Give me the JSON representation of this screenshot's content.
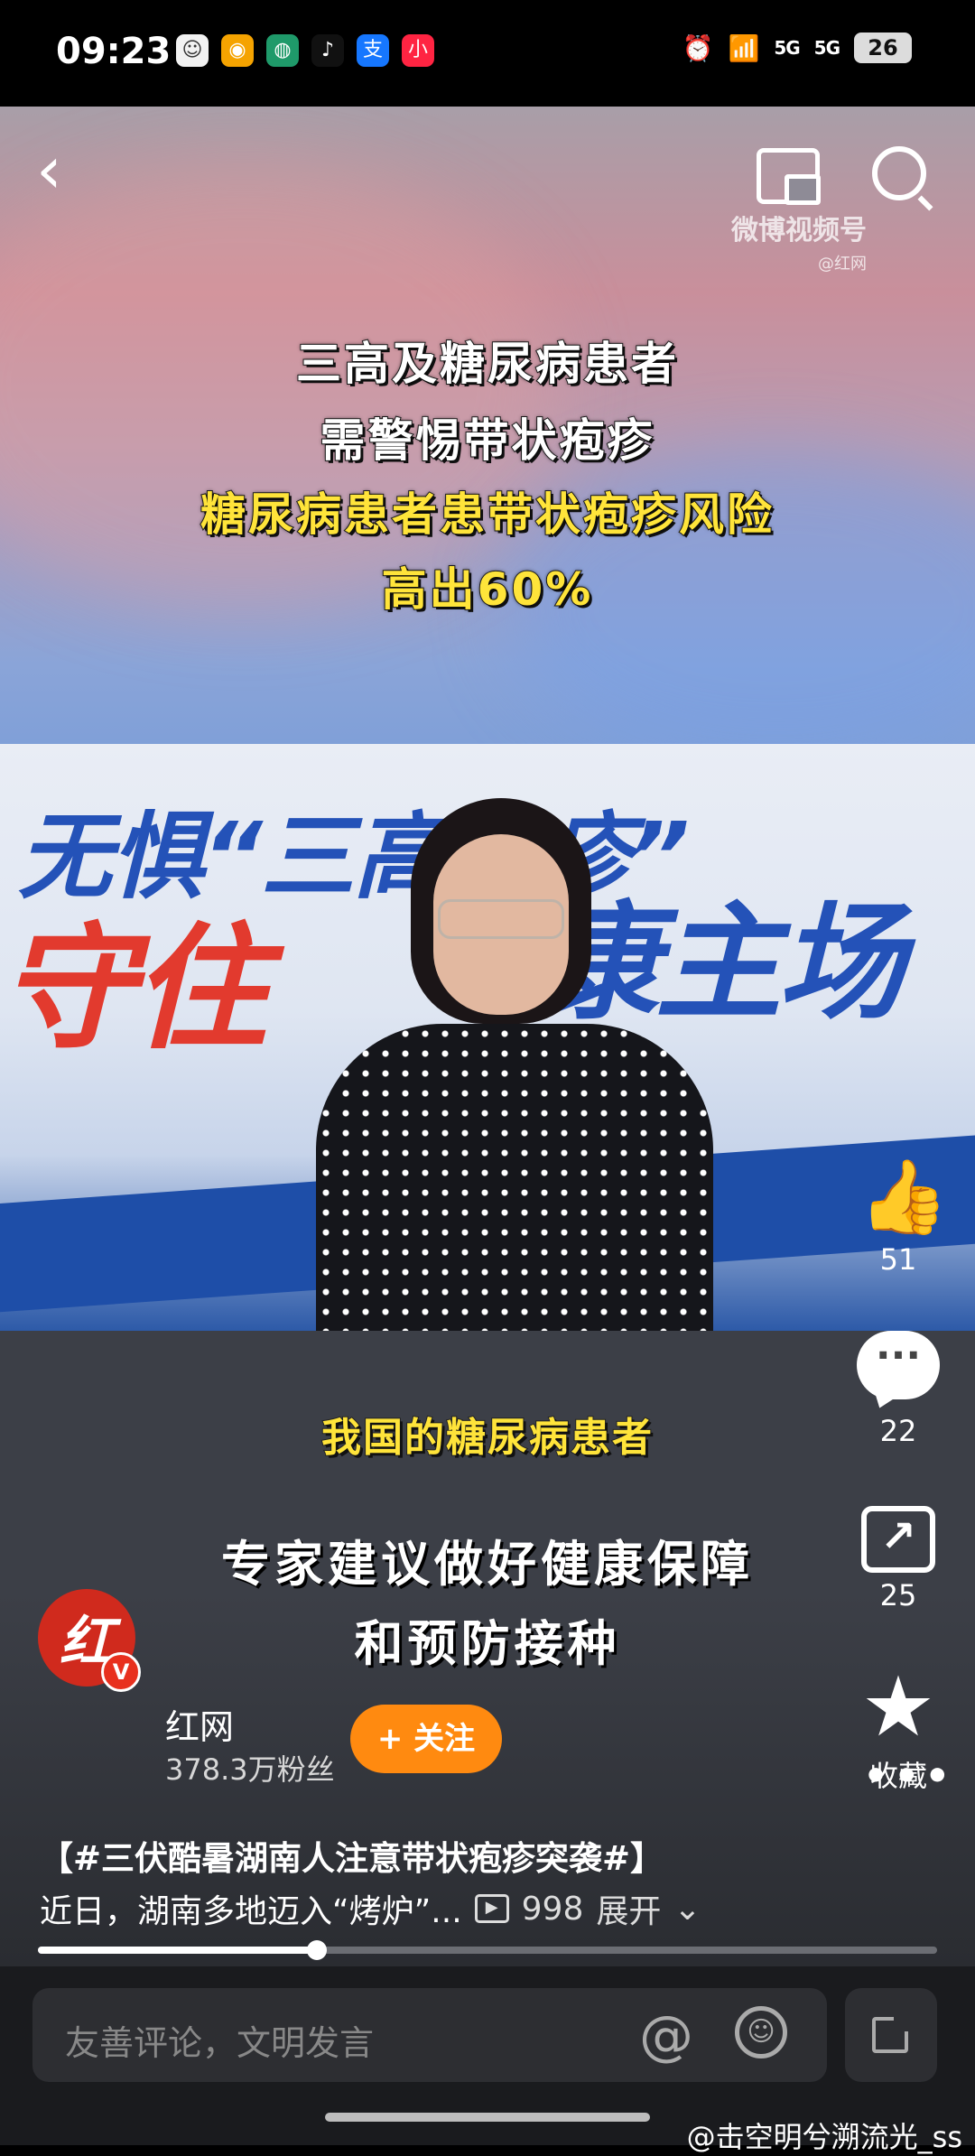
{
  "status_bar": {
    "time": "09:23",
    "app_icons": [
      {
        "name": "photo-app-icon",
        "glyph": "☺",
        "color": "#f2f2f2"
      },
      {
        "name": "weibo-icon",
        "glyph": "◉",
        "color": "#f5a300"
      },
      {
        "name": "agri-bank-icon",
        "glyph": "◍",
        "color": "#1f9a6a"
      },
      {
        "name": "tiktok-icon",
        "glyph": "♪",
        "color": "#111111"
      },
      {
        "name": "alipay-icon",
        "glyph": "支",
        "color": "#1677ff"
      },
      {
        "name": "xiaohongshu-icon",
        "glyph": "小",
        "color": "#ff2442"
      }
    ],
    "signal1": "5G",
    "signal2": "5G",
    "battery": "26"
  },
  "video": {
    "watermark_main": "微博视频号",
    "watermark_sub": "@红网",
    "captions": [
      "三高及糖尿病患者",
      "需警惕带状疱疹",
      "糖尿病患者患带状疱疹风险",
      "高出60%"
    ],
    "background_text_1": "无惧“三高一疹”",
    "background_text_2": "守住",
    "background_text_3": "康主场",
    "subtitle_yellow": "我国的糖尿病患者",
    "subtitle_white_1": "专家建议做好健康保障",
    "subtitle_white_2": "和预防接种"
  },
  "actions": {
    "likes": "51",
    "comments": "22",
    "shares": "25",
    "favorite_label": "收藏"
  },
  "author": {
    "name": "红网",
    "fans": "378.3万粉丝",
    "follow_label": "+ 关注"
  },
  "post": {
    "title": "【#三伏酷暑湖南人注意带状疱疹突袭#】",
    "description": "近日，湖南多地迈入“烤炉”...",
    "play_count": "998",
    "expand_label": "展开"
  },
  "progress": {
    "fraction": 0.31
  },
  "bottom": {
    "comment_placeholder": "友善评论，文明发言",
    "at_symbol": "@",
    "credit": "@击空明兮溯流光_ss"
  },
  "colors": {
    "accent": "#ff8a10",
    "caption_yellow": "#ffe43a"
  }
}
